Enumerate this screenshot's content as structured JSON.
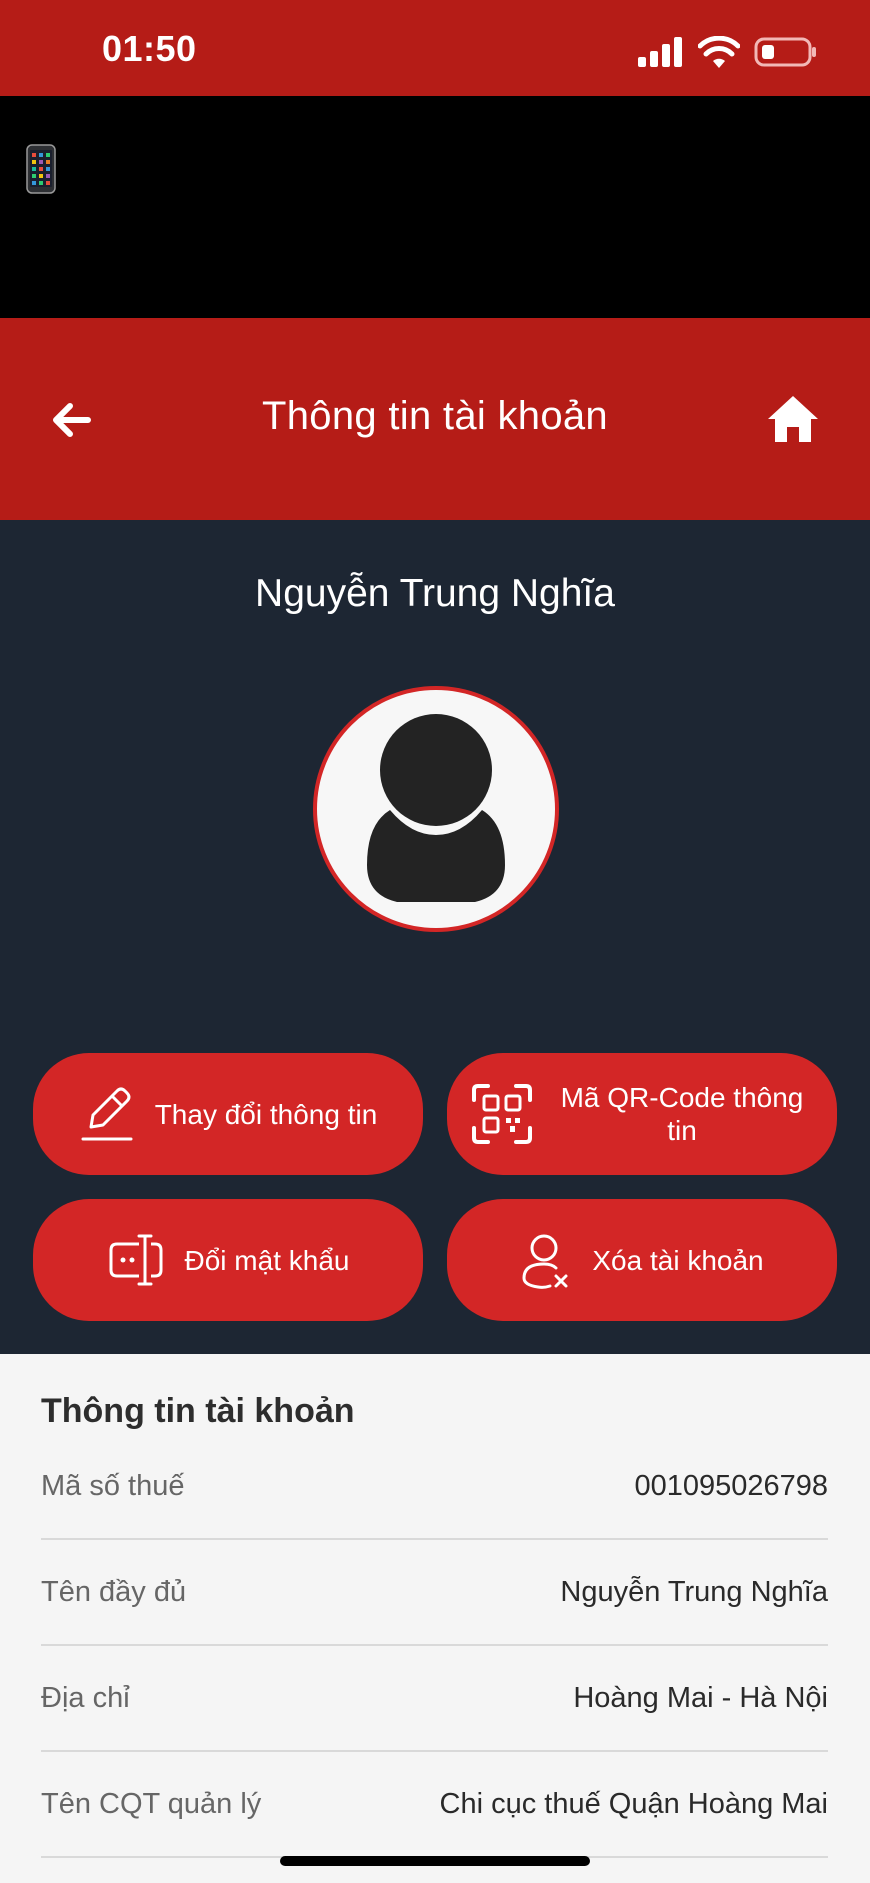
{
  "status_bar": {
    "time": "01:50"
  },
  "header": {
    "title": "Thông tin tài khoản"
  },
  "profile": {
    "name": "Nguyễn Trung Nghĩa"
  },
  "actions": {
    "edit_label": "Thay đổi thông tin",
    "qr_label": "Mã QR-Code thông tin",
    "password_label": "Đổi mật khẩu",
    "delete_label": "Xóa tài khoản"
  },
  "info": {
    "title": "Thông tin tài khoản",
    "rows": [
      {
        "label": "Mã số thuế",
        "value": "001095026798"
      },
      {
        "label": "Tên đầy đủ",
        "value": "Nguyễn Trung Nghĩa"
      },
      {
        "label": "Địa chỉ",
        "value": "Hoàng Mai - Hà Nội"
      },
      {
        "label": "Tên CQT quản lý",
        "value": "Chi cục thuế Quận Hoàng Mai"
      }
    ]
  },
  "colors": {
    "brand_red": "#b51c17",
    "button_red": "#d32626",
    "profile_bg": "#1d2633"
  },
  "icons": [
    "signal-icon",
    "wifi-icon",
    "battery-icon",
    "phone-icon",
    "back-arrow-icon",
    "home-icon",
    "avatar-placeholder-icon",
    "pencil-icon",
    "qr-code-icon",
    "password-icon",
    "delete-user-icon"
  ]
}
